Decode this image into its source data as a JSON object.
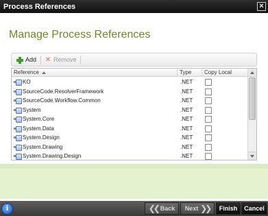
{
  "window": {
    "title": "Process References",
    "close_glyph": "×"
  },
  "page": {
    "title": "Manage Process References"
  },
  "toolbar": {
    "add_label": "Add",
    "remove_label": "Remove"
  },
  "grid": {
    "columns": [
      "Reference",
      "Type",
      "Copy Local"
    ],
    "rows": [
      {
        "reference": "KO",
        "type": ".NET",
        "copy_local": false
      },
      {
        "reference": "SourceCode.ResolverFramework",
        "type": ".NET",
        "copy_local": false
      },
      {
        "reference": "SourceCode.Workflow.Common",
        "type": ".NET",
        "copy_local": false
      },
      {
        "reference": "System",
        "type": ".NET",
        "copy_local": false
      },
      {
        "reference": "System.Core",
        "type": ".NET",
        "copy_local": false
      },
      {
        "reference": "System.Data",
        "type": ".NET",
        "copy_local": false
      },
      {
        "reference": "System.Design",
        "type": ".NET",
        "copy_local": false
      },
      {
        "reference": "System.Drawing",
        "type": ".NET",
        "copy_local": false
      },
      {
        "reference": "System.Drawing.Design",
        "type": ".NET",
        "copy_local": false
      }
    ]
  },
  "footer": {
    "info_glyph": "i",
    "back_label": "Back",
    "next_label": "Next",
    "finish_label": "Finish",
    "cancel_label": "Cancel"
  },
  "colors": {
    "accent_green": "#6e8a23",
    "band_green": "#e4f2cf"
  }
}
